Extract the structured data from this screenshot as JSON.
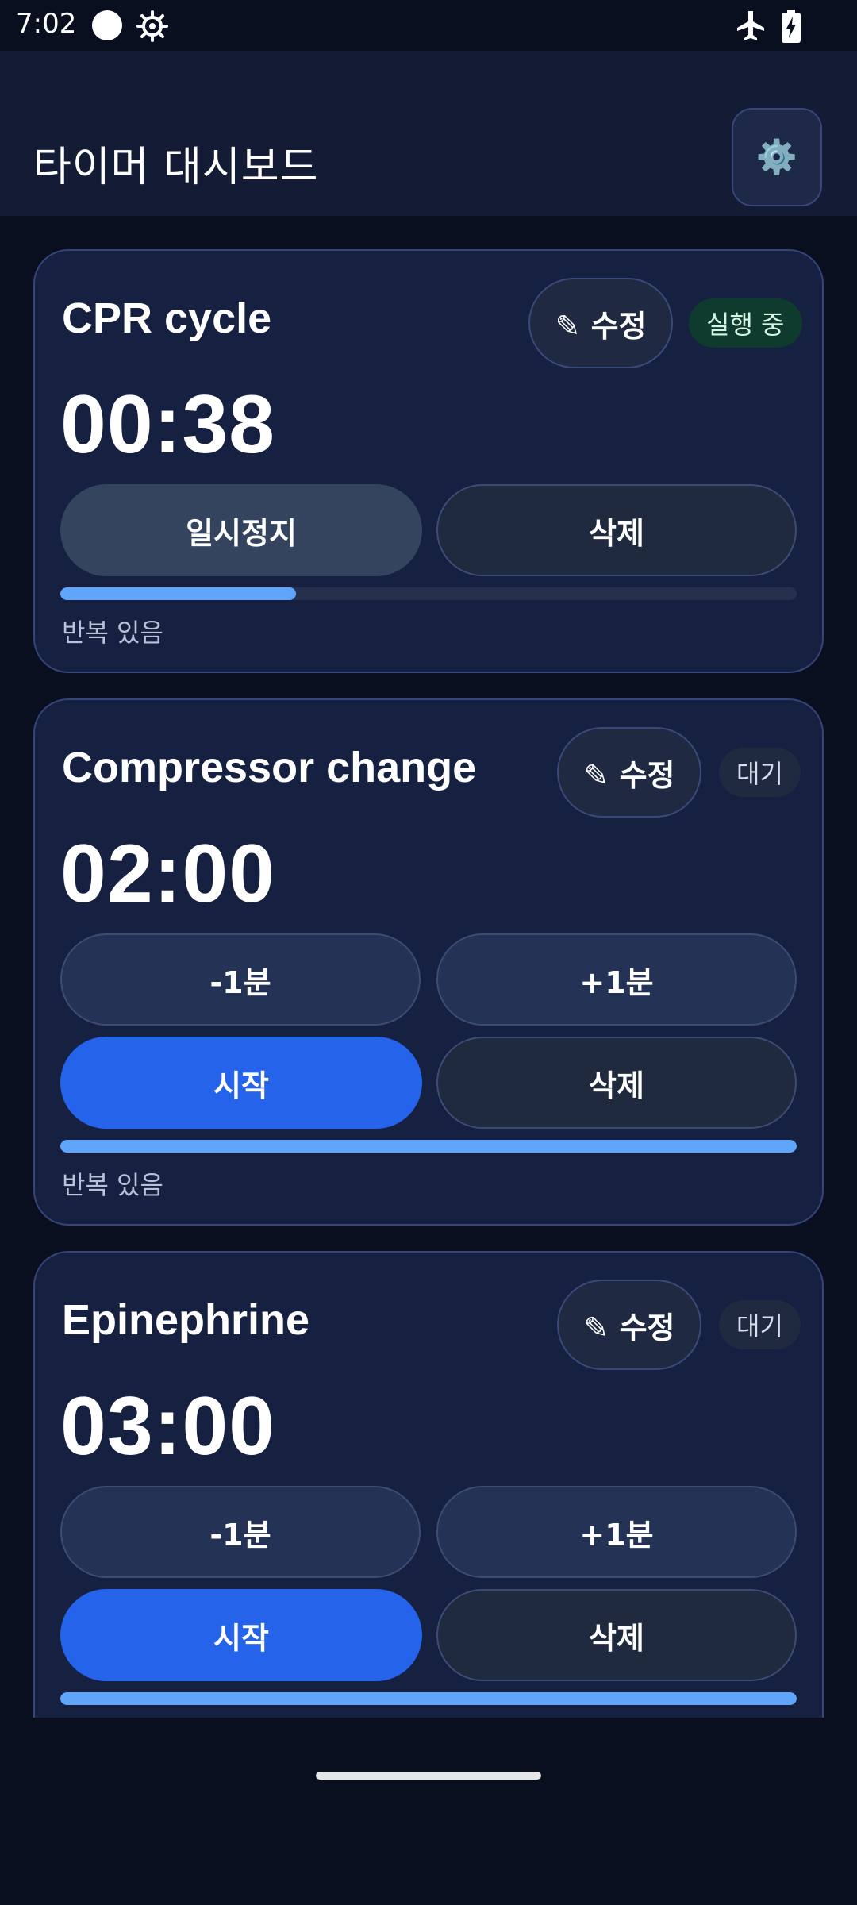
{
  "status_bar": {
    "time": "7:02",
    "icons": [
      "circle-icon",
      "gear-icon",
      "airplane-icon",
      "battery-charging-icon"
    ]
  },
  "app_bar": {
    "title": "타이머 대시보드",
    "settings_icon": "⚙️"
  },
  "colors": {
    "background": "#0a0f1f",
    "card": "#162040",
    "accent": "#2563eb",
    "progress": "#60a5fa",
    "running_badge": "#0f3a2e"
  },
  "timers": [
    {
      "name": "CPR cycle",
      "edit_label": "✎ 수정",
      "status": "실행 중",
      "time": "00:38",
      "primary_label": "일시정지",
      "delete_label": "삭제",
      "progress": 0.32,
      "repeat_label": "반복 있음"
    },
    {
      "name": "Compressor change",
      "edit_label": "✎ 수정",
      "status": "대기",
      "time": "02:00",
      "minus_label": "-1분",
      "plus_label": "+1분",
      "primary_label": "시작",
      "delete_label": "삭제",
      "progress": 1.0,
      "repeat_label": "반복 있음"
    },
    {
      "name": "Epinephrine",
      "edit_label": "✎ 수정",
      "status": "대기",
      "time": "03:00",
      "minus_label": "-1분",
      "plus_label": "+1분",
      "primary_label": "시작",
      "delete_label": "삭제",
      "progress": 1.0
    }
  ]
}
